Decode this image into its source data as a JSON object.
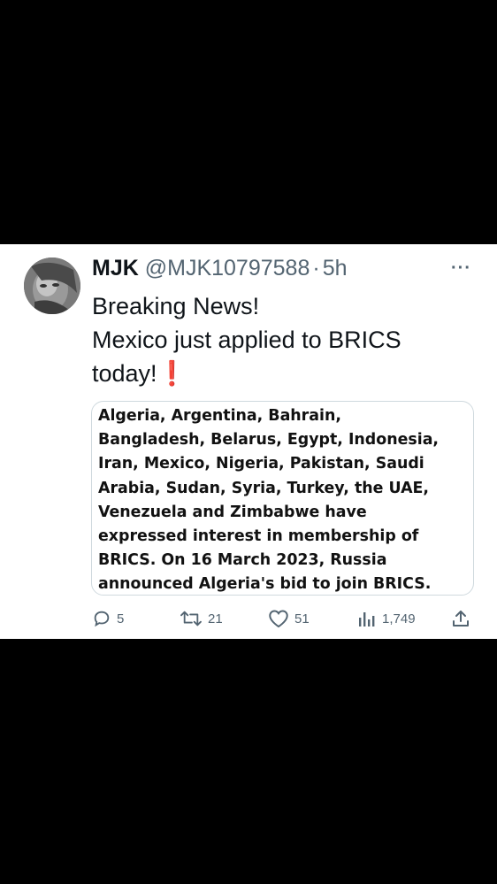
{
  "tweet": {
    "author_name": "MJK",
    "handle": "@MJK10797588",
    "separator": "·",
    "time": "5h",
    "more_label": "···",
    "text_lines": [
      "Breaking News!",
      "Mexico just applied to BRICS",
      "today!"
    ],
    "emoji": "❗",
    "media_lines": [
      "Algeria, Argentina, Bahrain,",
      "Bangladesh, Belarus, Egypt, Indonesia,",
      "Iran, Mexico, Nigeria, Pakistan, Saudi",
      "Arabia, Sudan, Syria, Turkey, the UAE,",
      "Venezuela and Zimbabwe have",
      "expressed interest in membership of",
      "BRICS. On 16 March 2023, Russia",
      "announced Algeria's bid to join BRICS."
    ]
  },
  "actions": {
    "reply_count": "5",
    "retweet_count": "21",
    "like_count": "51",
    "view_count": "1,749"
  },
  "icons": {
    "reply": "reply-icon",
    "retweet": "retweet-icon",
    "like": "heart-icon",
    "views": "views-icon",
    "share": "share-icon",
    "more": "more-icon"
  }
}
